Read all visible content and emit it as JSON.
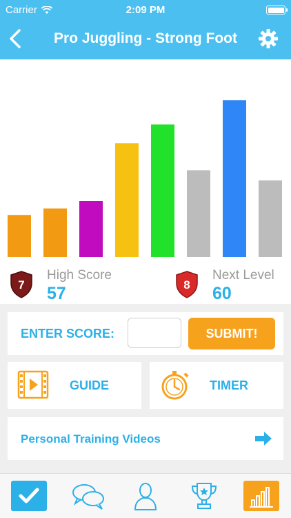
{
  "status_bar": {
    "carrier": "Carrier",
    "time": "2:09 PM"
  },
  "nav": {
    "title": "Pro Juggling - Strong Foot"
  },
  "chart_data": {
    "type": "bar",
    "values": [
      45,
      52,
      60,
      122,
      142,
      93,
      168,
      82
    ],
    "colors": [
      "#f39a13",
      "#f39a13",
      "#c10bbf",
      "#f6c110",
      "#21e12b",
      "#bcbcbc",
      "#2f86f6",
      "#bcbcbc"
    ],
    "ylim": [
      0,
      200
    ],
    "grid": false
  },
  "stats": {
    "high_score": {
      "badge": "7",
      "label": "High Score",
      "value": "57",
      "color": "#7c1a1a"
    },
    "next_level": {
      "badge": "8",
      "label": "Next Level",
      "value": "60",
      "color": "#d92a2a"
    }
  },
  "enter_score": {
    "label": "ENTER SCORE:",
    "value": "",
    "submit_label": "SUBMIT!"
  },
  "actions": {
    "guide_label": "GUIDE",
    "timer_label": "TIMER"
  },
  "videos": {
    "label": "Personal Training Videos"
  },
  "colors": {
    "header": "#4bc0f0",
    "accent_text": "#2bb0e8",
    "orange": "#f7a21d"
  }
}
